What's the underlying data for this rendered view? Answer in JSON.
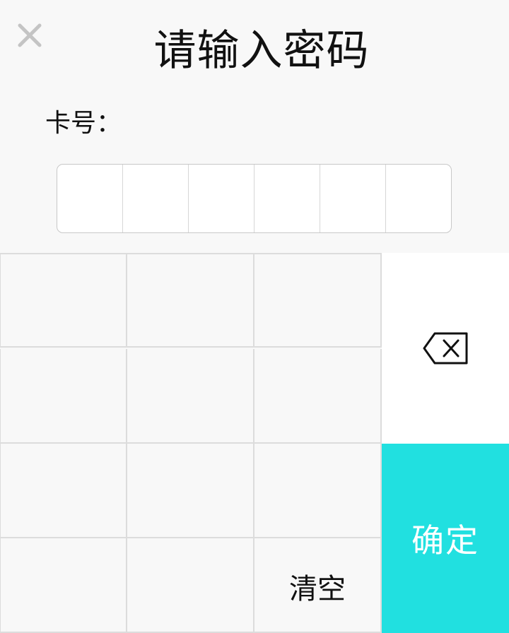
{
  "header": {
    "title": "请输入密码",
    "close_icon": "close-icon"
  },
  "card": {
    "label": "卡号：",
    "value": ""
  },
  "password": {
    "digits": [
      "",
      "",
      "",
      "",
      "",
      ""
    ]
  },
  "keypad": {
    "keys": [
      "",
      "",
      "",
      "",
      "",
      "",
      "",
      "",
      "",
      "",
      "",
      "清空"
    ],
    "backspace_icon": "backspace-icon",
    "confirm_label": "确定"
  },
  "colors": {
    "confirm_bg": "#21e0e0",
    "background": "#f8f8f8"
  }
}
